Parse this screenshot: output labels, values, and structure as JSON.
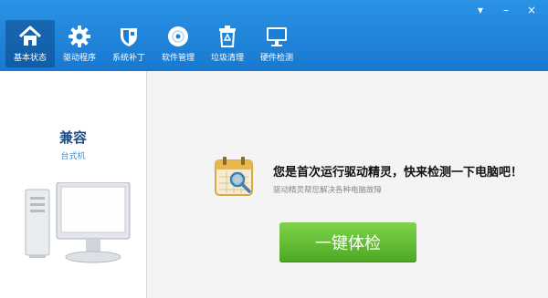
{
  "window": {
    "controls": [
      "▾",
      "–",
      "×"
    ]
  },
  "nav": {
    "items": [
      {
        "label": "基本状态",
        "icon": "home-icon",
        "active": true
      },
      {
        "label": "驱动程序",
        "icon": "gear-icon",
        "active": false
      },
      {
        "label": "系统补丁",
        "icon": "shield-icon",
        "active": false
      },
      {
        "label": "软件管理",
        "icon": "disc-icon",
        "active": false
      },
      {
        "label": "垃圾清理",
        "icon": "trash-icon",
        "active": false
      },
      {
        "label": "硬件检测",
        "icon": "monitor-icon",
        "active": false
      }
    ]
  },
  "left": {
    "compat": "兼容",
    "device_type": "台式机",
    "image_icon": "desktop-computer-icon"
  },
  "main": {
    "headline": "您是首次运行驱动精灵，快来检测一下电脑吧！",
    "subline": "驱动精灵帮您解决各种电脑故障",
    "banner_icon": "calendar-search-icon",
    "check_button": "一键体检"
  },
  "colors": {
    "header": "#1f84d8",
    "button": "#5cb82e",
    "title": "#1c4f88"
  }
}
